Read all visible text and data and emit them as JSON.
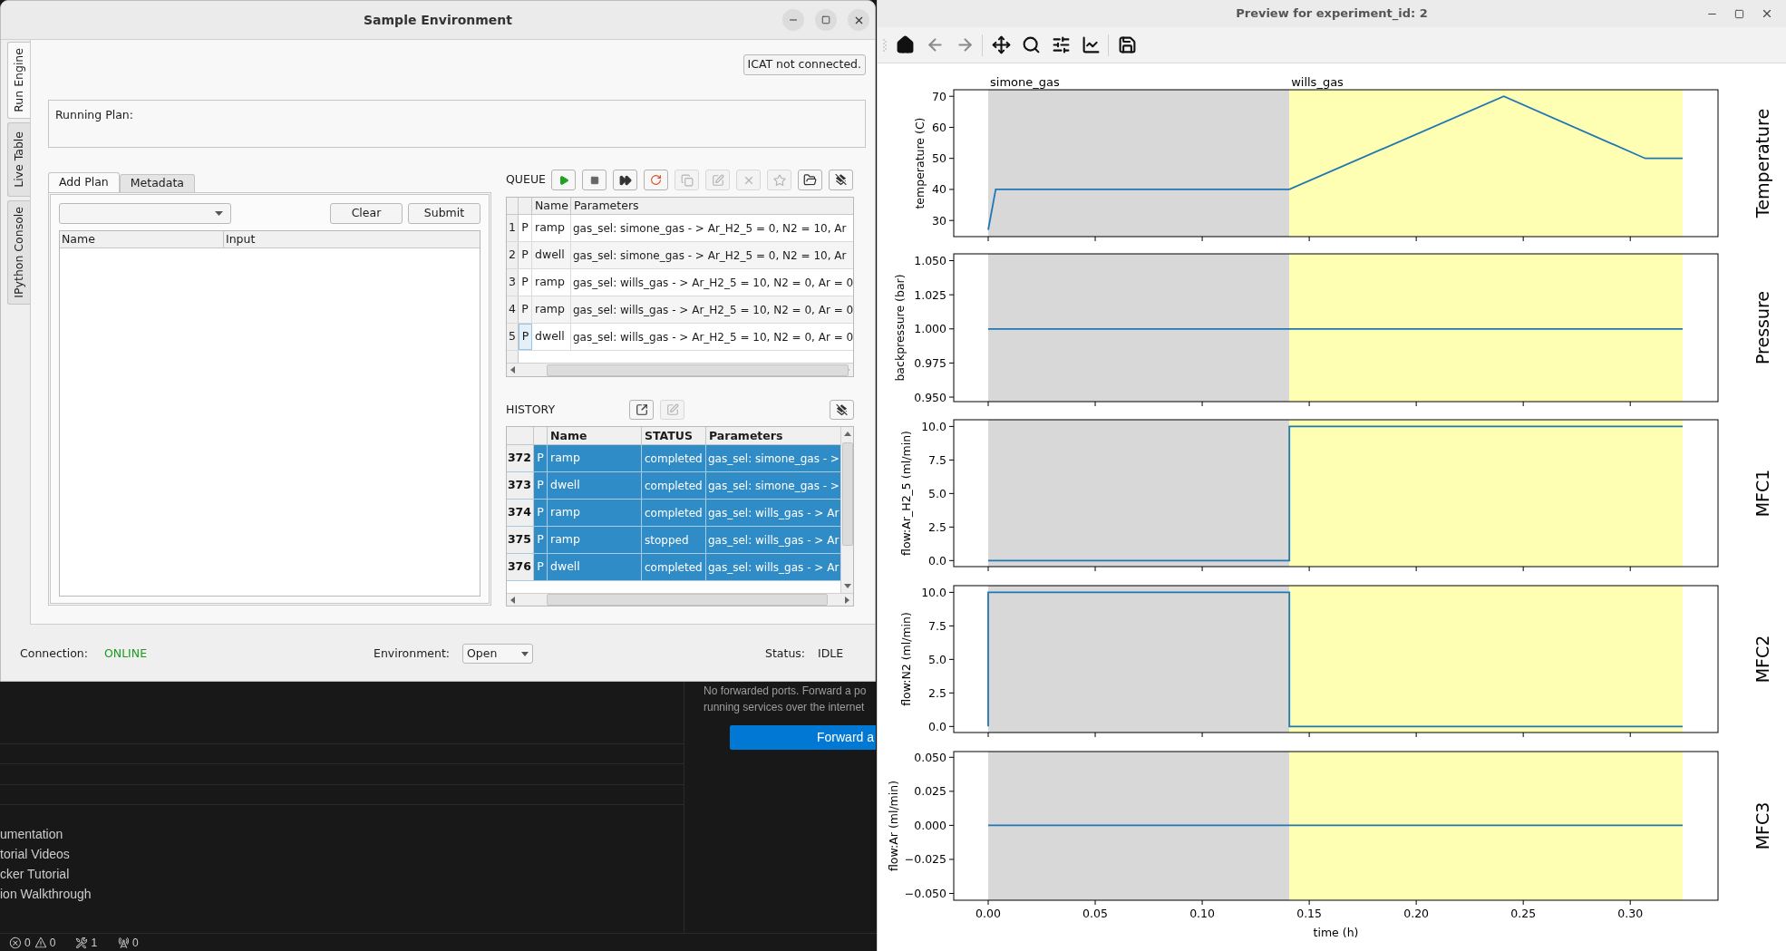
{
  "left_window": {
    "title": "Sample Environment",
    "side_tabs": [
      {
        "label": "Run Engine",
        "selected": true
      },
      {
        "label": "Live Table",
        "selected": false
      },
      {
        "label": "IPython Console",
        "selected": false
      }
    ],
    "icat_button": "ICAT not connected.",
    "running_plan": {
      "label": "Running Plan:"
    },
    "plan_tabs": [
      {
        "label": "Add Plan",
        "selected": true
      },
      {
        "label": "Metadata",
        "selected": false
      }
    ],
    "plan_buttons": [
      "Clear",
      "Submit"
    ],
    "plan_table": {
      "columns": [
        "Name",
        "Input"
      ]
    },
    "queue": {
      "label": "QUEUE",
      "buttons": [
        {
          "kind": "play",
          "disabled": false
        },
        {
          "kind": "stop",
          "disabled": false
        },
        {
          "kind": "fast-forward",
          "disabled": false
        },
        {
          "kind": "restart",
          "disabled": false
        },
        {
          "kind": "copy",
          "disabled": true
        },
        {
          "kind": "edit",
          "disabled": true
        },
        {
          "kind": "delete",
          "disabled": true
        },
        {
          "kind": "favorite",
          "disabled": true
        },
        {
          "kind": "open",
          "disabled": false
        },
        {
          "kind": "clear",
          "disabled": false
        }
      ],
      "columns": [
        "Name",
        "Parameters"
      ],
      "rows": [
        {
          "index": "1",
          "type": "P",
          "name": "ramp",
          "parameters": "gas_sel: simone_gas - > Ar_H2_5 = 0, N2 = 10, Ar",
          "focused": false
        },
        {
          "index": "2",
          "type": "P",
          "name": "dwell",
          "parameters": "gas_sel: simone_gas - > Ar_H2_5 = 0, N2 = 10, Ar",
          "focused": false
        },
        {
          "index": "3",
          "type": "P",
          "name": "ramp",
          "parameters": "gas_sel: wills_gas - > Ar_H2_5 = 10, N2 = 0, Ar = 0",
          "focused": false
        },
        {
          "index": "4",
          "type": "P",
          "name": "ramp",
          "parameters": "gas_sel: wills_gas - > Ar_H2_5 = 10, N2 = 0, Ar = 0",
          "focused": false
        },
        {
          "index": "5",
          "type": "P",
          "name": "dwell",
          "parameters": "gas_sel: wills_gas - > Ar_H2_5 = 10, N2 = 0, Ar = 0",
          "focused": true
        }
      ]
    },
    "history": {
      "label": "HISTORY",
      "buttons": [
        {
          "kind": "export",
          "disabled": false
        },
        {
          "kind": "edit",
          "disabled": true
        },
        {
          "kind": "clear",
          "disabled": false
        }
      ],
      "columns": [
        "Name",
        "STATUS",
        "Parameters"
      ],
      "rows": [
        {
          "index": "372",
          "type": "P",
          "name": "ramp",
          "status": "completed",
          "parameters": "gas_sel: simone_gas - >",
          "selected": true
        },
        {
          "index": "373",
          "type": "P",
          "name": "dwell",
          "status": "completed",
          "parameters": "gas_sel: simone_gas - >",
          "selected": true
        },
        {
          "index": "374",
          "type": "P",
          "name": "ramp",
          "status": "completed",
          "parameters": "gas_sel: wills_gas - > Ar",
          "selected": true
        },
        {
          "index": "375",
          "type": "P",
          "name": "ramp",
          "status": "stopped",
          "parameters": "gas_sel: wills_gas - > Ar",
          "selected": true
        },
        {
          "index": "376",
          "type": "P",
          "name": "dwell",
          "status": "completed",
          "parameters": "gas_sel: wills_gas - > Ar",
          "selected": true
        }
      ]
    },
    "status_bar": {
      "connection_label": "Connection:",
      "connection": "ONLINE",
      "online": true,
      "environment_label": "Environment:",
      "environment": "Open",
      "status_label": "Status:",
      "status": "IDLE"
    }
  },
  "background_editor": {
    "ports_message": [
      "No forwarded ports. Forward a po",
      "running services over the internet"
    ],
    "forward_button": "Forward a",
    "links": [
      "umentation",
      "torial Videos",
      "cker Tutorial",
      "ion Walkthrough"
    ],
    "status": [
      {
        "kind": "errors",
        "count": "0"
      },
      {
        "kind": "warnings",
        "count": "0"
      },
      {
        "kind": "tools",
        "count": "1"
      },
      {
        "kind": "ports",
        "count": "0"
      }
    ]
  },
  "preview_window": {
    "title": "Preview for experiment_id: 2",
    "toolbar": [
      {
        "kind": "home",
        "disabled": false
      },
      {
        "kind": "back",
        "disabled": true
      },
      {
        "kind": "forward",
        "disabled": true
      },
      {
        "kind": "pan",
        "disabled": false
      },
      {
        "kind": "zoom",
        "disabled": false
      },
      {
        "kind": "configure",
        "disabled": false
      },
      {
        "kind": "axes",
        "disabled": false
      },
      {
        "kind": "save",
        "disabled": false
      }
    ],
    "plots": [
      {
        "label": "Temperature",
        "chart_data": {
          "type": "line",
          "ylabel": "temperature (C)",
          "xlim": [
            -0.0161,
            0.341
          ],
          "ylim": [
            24.8,
            72.1
          ],
          "yticks": [
            {
              "value": 30,
              "label": "30"
            },
            {
              "value": 40,
              "label": "40"
            },
            {
              "value": 50,
              "label": "50"
            },
            {
              "value": 60,
              "label": "60"
            },
            {
              "value": 70,
              "label": "70"
            }
          ],
          "x": [
            0,
            0.0035,
            0.1407,
            0.2409,
            0.307,
            0.3245
          ],
          "series": [
            {
              "color": "#1f77b4",
              "values": [
                27,
                40,
                40,
                70,
                50,
                50
              ]
            }
          ]
        }
      },
      {
        "label": "Pressure",
        "chart_data": {
          "type": "line",
          "ylabel": "backpressure (bar)",
          "xlim": [
            -0.0161,
            0.341
          ],
          "ylim": [
            0.9467,
            1.055
          ],
          "yticks": [
            {
              "value": 0.95,
              "label": "0.950"
            },
            {
              "value": 0.975,
              "label": "0.975"
            },
            {
              "value": 1.0,
              "label": "1.000"
            },
            {
              "value": 1.025,
              "label": "1.025"
            },
            {
              "value": 1.05,
              "label": "1.050"
            }
          ],
          "x": [
            0,
            0.3245
          ],
          "series": [
            {
              "color": "#1f77b4",
              "values": [
                1.0,
                1.0
              ]
            }
          ]
        }
      },
      {
        "label": "MFC1",
        "chart_data": {
          "type": "line",
          "ylabel": "flow:Ar_H2_5 (ml/min)",
          "xlim": [
            -0.0161,
            0.341
          ],
          "ylim": [
            -0.45,
            10.5
          ],
          "yticks": [
            {
              "value": 0,
              "label": "0.0"
            },
            {
              "value": 2.5,
              "label": "2.5"
            },
            {
              "value": 5,
              "label": "5.0"
            },
            {
              "value": 7.5,
              "label": "7.5"
            },
            {
              "value": 10,
              "label": "10.0"
            }
          ],
          "x": [
            0,
            0.1407,
            0.1407,
            0.3245
          ],
          "series": [
            {
              "color": "#1f77b4",
              "values": [
                0,
                0,
                10,
                10
              ]
            }
          ]
        }
      },
      {
        "label": "MFC2",
        "chart_data": {
          "type": "line",
          "ylabel": "flow:N2 (ml/min)",
          "xlim": [
            -0.0161,
            0.341
          ],
          "ylim": [
            -0.45,
            10.5
          ],
          "yticks": [
            {
              "value": 0,
              "label": "0.0"
            },
            {
              "value": 2.5,
              "label": "2.5"
            },
            {
              "value": 5,
              "label": "5.0"
            },
            {
              "value": 7.5,
              "label": "7.5"
            },
            {
              "value": 10,
              "label": "10.0"
            }
          ],
          "x": [
            0,
            0,
            0.1407,
            0.1407,
            0.3245
          ],
          "series": [
            {
              "color": "#1f77b4",
              "values": [
                0,
                10,
                10,
                0,
                0
              ]
            }
          ]
        }
      },
      {
        "label": "MFC3",
        "chart_data": {
          "type": "line",
          "ylabel": "flow:Ar (ml/min)",
          "xlabel": "time (h)",
          "xlim": [
            -0.0161,
            0.341
          ],
          "ylim": [
            -0.055,
            0.0542
          ],
          "xticks": [
            {
              "value": 0,
              "label": "0.00"
            },
            {
              "value": 0.05,
              "label": "0.05"
            },
            {
              "value": 0.1,
              "label": "0.10"
            },
            {
              "value": 0.15,
              "label": "0.15"
            },
            {
              "value": 0.2,
              "label": "0.20"
            },
            {
              "value": 0.25,
              "label": "0.25"
            },
            {
              "value": 0.3,
              "label": "0.30"
            }
          ],
          "yticks": [
            {
              "value": -0.05,
              "label": "−0.050"
            },
            {
              "value": -0.025,
              "label": "−0.025"
            },
            {
              "value": 0,
              "label": "0.000"
            },
            {
              "value": 0.025,
              "label": "0.025"
            },
            {
              "value": 0.05,
              "label": "0.050"
            }
          ],
          "x": [
            0,
            0.3245
          ],
          "series": [
            {
              "color": "#1f77b4",
              "values": [
                0,
                0
              ]
            }
          ]
        }
      }
    ],
    "phases": [
      {
        "name": "simone_gas",
        "color": "#d8d8d8"
      },
      {
        "name": "wills_gas",
        "color": "#ffffb3"
      }
    ]
  }
}
